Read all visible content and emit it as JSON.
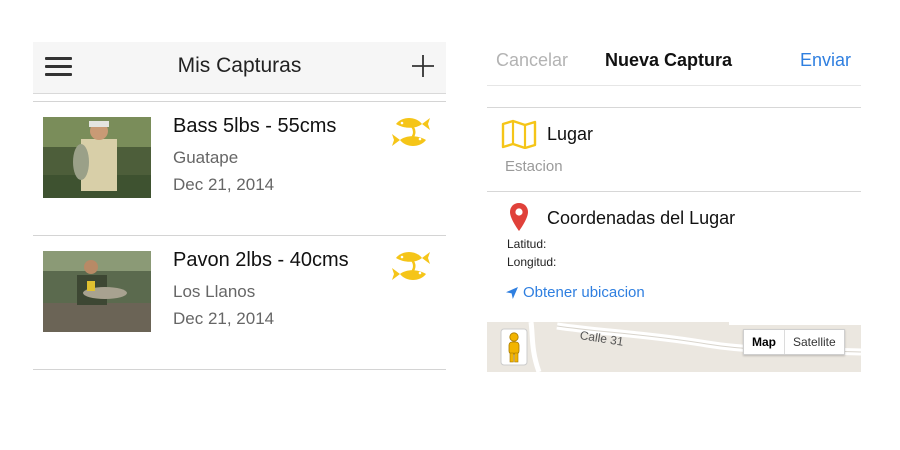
{
  "catches_list": {
    "title": "Mis Capturas",
    "menu_icon": "hamburger-menu-icon",
    "add_icon": "plus-icon",
    "items": [
      {
        "title": "Bass 5lbs - 55cms",
        "place": "Guatape",
        "date": "Dec 21, 2014",
        "icon": "fish-icon"
      },
      {
        "title": "Pavon 2lbs - 40cms",
        "place": "Los Llanos",
        "date": "Dec 21, 2014",
        "icon": "fish-icon"
      }
    ]
  },
  "new_catch": {
    "cancel_label": "Cancelar",
    "title": "Nueva Captura",
    "send_label": "Enviar",
    "place_label": "Lugar",
    "place_placeholder": "Estacion",
    "coords_label": "Coordenadas del Lugar",
    "latitude_label": "Latitud:",
    "longitude_label": "Longitud:",
    "get_location_label": "Obtener ubicacion",
    "map": {
      "street_label": "Calle 31",
      "map_button": "Map",
      "satellite_button": "Satellite",
      "selected": "Map"
    }
  },
  "colors": {
    "accent_blue": "#2f7fe0",
    "fish_yellow": "#f5c518",
    "pin_red": "#e0413a",
    "header_bg": "#f6f6f6"
  }
}
